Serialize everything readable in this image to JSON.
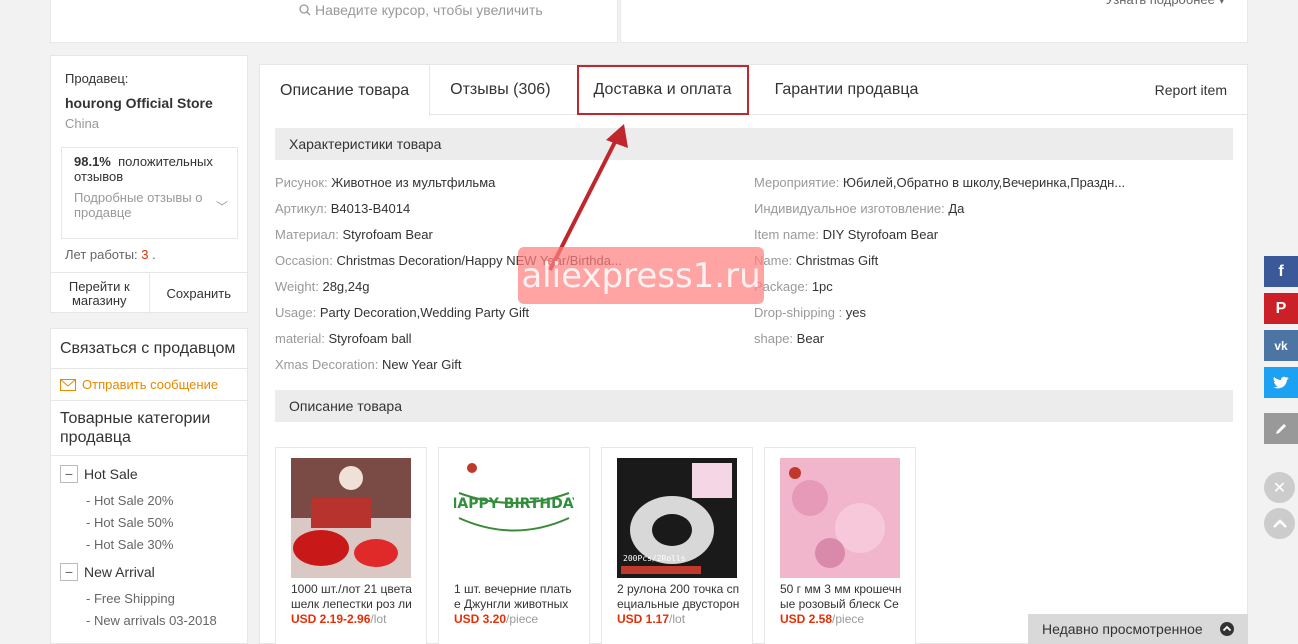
{
  "top": {
    "zoom_hint": "Наведите курсор, чтобы увеличить",
    "more_details": "Узнать подробнее ▾"
  },
  "seller": {
    "label": "Продавец:",
    "store_name": "hourong Official Store",
    "country": "China",
    "feedback_percent": "98.1%",
    "feedback_text": "положительных отзывов",
    "feedback_detail": "Подробные отзывы о продавце",
    "years_label": "Лет работы:",
    "years_value": "3",
    "years_suffix": ".",
    "visit_store": "Перейти к магазину",
    "save": "Сохранить"
  },
  "sidebar": {
    "contact_title": "Связаться с продавцом",
    "send_message": "Отправить сообщение",
    "categories_title": "Товарные категории продавца",
    "groups": [
      {
        "name": "Hot Sale",
        "items": [
          "- Hot Sale 20%",
          "- Hot Sale 50%",
          "- Hot Sale 30%"
        ]
      },
      {
        "name": "New Arrival",
        "items": [
          "- Free Shipping",
          "- New arrivals 03-2018"
        ]
      }
    ]
  },
  "tabs": {
    "description": "Описание товара",
    "reviews": "Отзывы (306)",
    "shipping": "Доставка и оплата",
    "guarantees": "Гарантии продавца",
    "report": "Report item"
  },
  "specs_title": "Характеристики товара",
  "specs": [
    {
      "k": "Рисунок:",
      "v": "Животное из мультфильма"
    },
    {
      "k": "Мероприятие:",
      "v": "Юбилей,Обратно в школу,Вечеринка,Праздн..."
    },
    {
      "k": "Артикул:",
      "v": "B4013-B4014"
    },
    {
      "k": "Индивидуальное изготовление:",
      "v": "Да"
    },
    {
      "k": "Материал:",
      "v": "Styrofoam Bear"
    },
    {
      "k": "Item name:",
      "v": "DIY Styrofoam Bear"
    },
    {
      "k": "Occasion:",
      "v": "Christmas Decoration/Happy NEW Year/Birthda..."
    },
    {
      "k": "Name:",
      "v": "Christmas Gift"
    },
    {
      "k": "Weight:",
      "v": "28g,24g"
    },
    {
      "k": "Package:",
      "v": "1pc"
    },
    {
      "k": "Usage:",
      "v": "Party Decoration,Wedding Party Gift"
    },
    {
      "k": "Drop-shipping :",
      "v": "yes"
    },
    {
      "k": "material:",
      "v": "Styrofoam ball"
    },
    {
      "k": "shape:",
      "v": "Bear"
    },
    {
      "k": "Xmas Decoration:",
      "v": "New Year Gift"
    }
  ],
  "desc_title": "Описание товара",
  "products": [
    {
      "title": "1000 шт./лот 21 цвета шелк лепестки роз ли",
      "price": "USD 2.19-2.96",
      "unit": "/lot",
      "img_text": ""
    },
    {
      "title": "1 шт. вечерние плать е Джунгли животных",
      "price": "USD 3.20",
      "unit": "/piece",
      "img_text": "HAPPY BIRTHDAY"
    },
    {
      "title": "2 рулона 200 точка сп ециальные двусторон",
      "price": "USD 1.17",
      "unit": "/lot",
      "img_text": "200Pcs/2Rolls"
    },
    {
      "title": "50 г мм 3 мм крошечн ые розовый блеск Се",
      "price": "USD 2.58",
      "unit": "/piece",
      "img_text": ""
    }
  ],
  "watermark": "aliexpress1.ru",
  "recent": "Недавно просмотренное",
  "colors": {
    "accent_red": "#e62e04",
    "highlight_border": "#c0272d",
    "facebook": "#3b5998",
    "pinterest": "#cb2027",
    "vk": "#4c75a3",
    "twitter": "#1da1f2"
  }
}
